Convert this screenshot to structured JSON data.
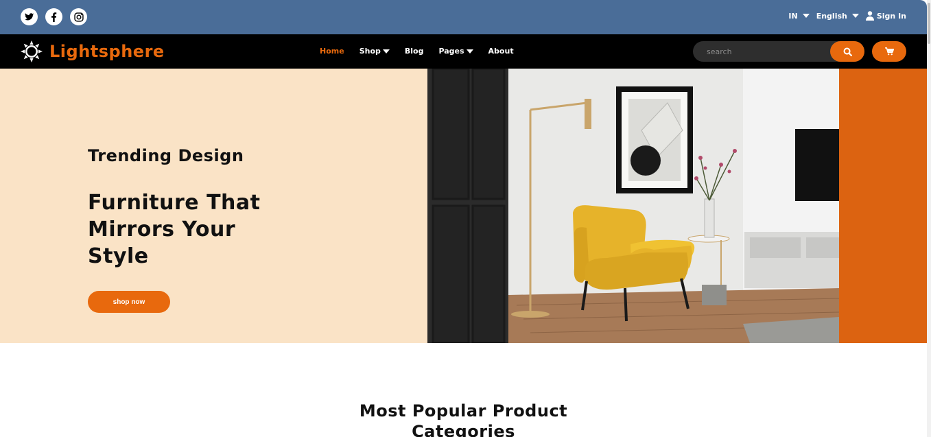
{
  "topbar": {
    "social": [
      {
        "icon": "twitter-icon"
      },
      {
        "icon": "facebook-icon"
      },
      {
        "icon": "instagram-icon"
      }
    ],
    "region": "IN",
    "language": "English",
    "signin_label": "Sign In",
    "color": "#4a6d98"
  },
  "navbar": {
    "brand": "Lightsphere",
    "menu": [
      {
        "label": "Home",
        "active": true
      },
      {
        "label": "Shop",
        "dropdown": true
      },
      {
        "label": "Blog"
      },
      {
        "label": "Pages",
        "dropdown": true
      },
      {
        "label": "About"
      }
    ],
    "search_placeholder": "search",
    "accent": "#e8690d"
  },
  "hero": {
    "subtitle": "Trending Design",
    "title_lines": [
      "Furniture That",
      "Mirrors Your",
      "Style"
    ],
    "button_label": "shop now",
    "bg_color": "#fae3c6"
  },
  "section": {
    "title_lines": [
      "Most Popular Product",
      "Categories"
    ]
  }
}
